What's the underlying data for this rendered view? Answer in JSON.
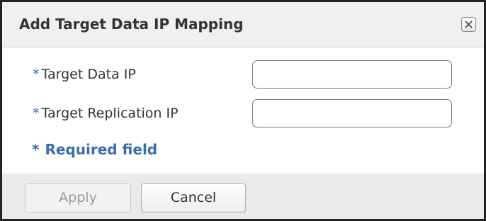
{
  "dialog": {
    "title": "Add Target Data IP Mapping",
    "close_icon": "close-icon"
  },
  "form": {
    "fields": [
      {
        "required_marker": "*",
        "label": "Target Data IP",
        "value": "",
        "placeholder": ""
      },
      {
        "required_marker": "*",
        "label": "Target Replication IP",
        "value": "",
        "placeholder": ""
      }
    ],
    "required_note": {
      "marker": "*",
      "text": "Required field"
    }
  },
  "buttons": {
    "apply_label": "Apply",
    "apply_enabled": false,
    "cancel_label": "Cancel"
  },
  "colors": {
    "accent": "#3b6ea5",
    "title_text": "#333333",
    "footer_bg": "#eaeaea",
    "disabled_text": "#9a9a9a"
  }
}
